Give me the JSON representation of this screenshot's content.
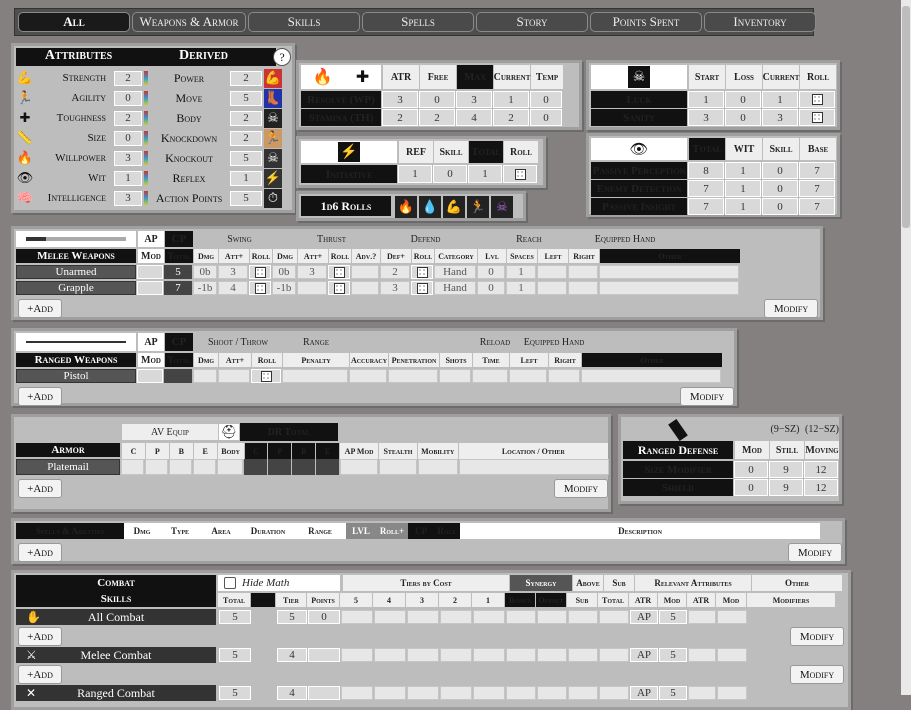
{
  "tabs": [
    "All",
    "Weapons & Armor",
    "Skills",
    "Spells",
    "Story",
    "Points Spent",
    "Inventory"
  ],
  "attributes": {
    "title": "Attributes",
    "derived_title": "Derived",
    "help": "?",
    "rows": [
      {
        "name": "Strength",
        "value": "2",
        "derived": "Power",
        "dval": "2"
      },
      {
        "name": "Agility",
        "value": "0",
        "derived": "Move",
        "dval": "5"
      },
      {
        "name": "Toughness",
        "value": "2",
        "derived": "Body",
        "dval": "2"
      },
      {
        "name": "Size",
        "value": "0",
        "derived": "Knockdown",
        "dval": "2"
      },
      {
        "name": "Willpower",
        "value": "3",
        "derived": "Knockout",
        "dval": "5"
      },
      {
        "name": "Wit",
        "value": "1",
        "derived": "Reflex",
        "dval": "1"
      },
      {
        "name": "Intelligence",
        "value": "3",
        "derived": "Action Points",
        "dval": "5"
      }
    ]
  },
  "resolve": {
    "headers": [
      "ATR",
      "Free",
      "Max",
      "Current",
      "Temp"
    ],
    "rows": [
      {
        "label": "Resolve (WP)",
        "vals": [
          "3",
          "0",
          "3",
          "1",
          "0"
        ]
      },
      {
        "label": "Stamina (TH)",
        "vals": [
          "2",
          "2",
          "4",
          "2",
          "0"
        ]
      }
    ]
  },
  "luck": {
    "headers": [
      "Start",
      "Loss",
      "Current",
      "Roll"
    ],
    "rows": [
      {
        "label": "Luck",
        "vals": [
          "1",
          "0",
          "1"
        ]
      },
      {
        "label": "Sanity",
        "vals": [
          "3",
          "0",
          "3"
        ]
      }
    ]
  },
  "initiative": {
    "headers": [
      "REF",
      "Skill",
      "Total",
      "Roll"
    ],
    "label": "Initiative",
    "vals": [
      "1",
      "0",
      "1"
    ]
  },
  "rolls": {
    "label": "1d6 Rolls"
  },
  "passive": {
    "headers": [
      "Total",
      "WIT",
      "Skill",
      "Base"
    ],
    "rows": [
      {
        "label": "Passive Perception",
        "vals": [
          "8",
          "1",
          "0",
          "7"
        ]
      },
      {
        "label": "Enemy Detection",
        "vals": [
          "7",
          "1",
          "0",
          "7"
        ]
      },
      {
        "label": "Passive Insight",
        "vals": [
          "7",
          "1",
          "0",
          "7"
        ]
      }
    ]
  },
  "melee": {
    "title": "Melee Weapons",
    "ap": "AP",
    "cp": "CP",
    "mod": "Mod",
    "total": "Total",
    "groups": [
      "Swing",
      "Thrust",
      "Defend",
      "Reach",
      "Equipped Hand"
    ],
    "sub": [
      "Dmg",
      "Att+",
      "Roll",
      "Dmg",
      "Att+",
      "Roll",
      "Adv.?",
      "Def+",
      "Roll",
      "Category",
      "Lvl",
      "Spaces",
      "Left",
      "Right",
      "Other"
    ],
    "rows": [
      {
        "name": "Unarmed",
        "cp": "5",
        "sdmg": "0b",
        "satt": "3",
        "tdmg": "0b",
        "tatt": "3",
        "def": "2",
        "cat": "Hand",
        "lvl": "0",
        "sp": "1"
      },
      {
        "name": "Grapple",
        "cp": "7",
        "sdmg": "-1b",
        "satt": "4",
        "tdmg": "-1b",
        "tatt": "",
        "def": "3",
        "cat": "Hand",
        "lvl": "0",
        "sp": "1"
      }
    ],
    "add": "+Add",
    "modify": "Modify"
  },
  "ranged": {
    "title": "Ranged Weapons",
    "ap": "AP",
    "cp": "CP",
    "mod": "Mod",
    "total": "Total",
    "groups": [
      "Shoot / Throw",
      "Range",
      "Reload",
      "Equipped Hand"
    ],
    "sub": [
      "Dmg",
      "Att+",
      "Roll",
      "Penalty",
      "Accuracy",
      "Penetration",
      "Shots",
      "Time",
      "Left",
      "Right",
      "Other"
    ],
    "rows": [
      {
        "name": "Pistol"
      }
    ],
    "add": "+Add",
    "modify": "Modify"
  },
  "armor": {
    "title": "Armor",
    "av": "AV Equip",
    "dr": "DR Total",
    "sub": [
      "C",
      "P",
      "B",
      "E",
      "Body",
      "C",
      "P",
      "B",
      "E",
      "AP Mod",
      "Stealth",
      "Mobility",
      "Location / Other"
    ],
    "rows": [
      {
        "name": "Platemail"
      }
    ],
    "add": "+Add",
    "modify": "Modify"
  },
  "rdef": {
    "title": "Ranged Defense",
    "hdr1": "(9−SZ)",
    "hdr2": "(12−SZ)",
    "headers": [
      "Mod",
      "Still",
      "Moving"
    ],
    "rows": [
      {
        "label": "Size Modifier",
        "vals": [
          "0",
          "9",
          "12"
        ]
      },
      {
        "label": "Shield",
        "vals": [
          "0",
          "9",
          "12"
        ]
      }
    ]
  },
  "spells": {
    "headers": [
      "Spells & Abilities",
      "Dmg",
      "Type",
      "Area",
      "Duration",
      "Range",
      "LVL",
      "Roll+",
      "CP",
      "Roll",
      "Description"
    ],
    "add": "+Add",
    "modify": "Modify"
  },
  "combat": {
    "title1": "Combat",
    "title2": "Skills",
    "hide": "Hide Math",
    "tiers": "Tiers by Cost",
    "synergy": "Synergy",
    "above": "Above",
    "sub": "Sub",
    "relevant": "Relevant Attributes",
    "other1": "Other",
    "other2": "Modifiers",
    "cols": [
      "Total",
      "Tier",
      "Points",
      "5",
      "4",
      "3",
      "2",
      "1",
      "Bonus",
      "Offset",
      "Sub",
      "Total",
      "ATR",
      "Mod",
      "ATR",
      "Mod"
    ],
    "rows": [
      {
        "name": "All Combat",
        "total": "5",
        "tier": "5",
        "points": "0",
        "atr": "AP",
        "mod": "5"
      },
      {
        "name": "Melee Combat",
        "total": "5",
        "tier": "4",
        "points": "",
        "atr": "AP",
        "mod": "5"
      },
      {
        "name": "Ranged Combat",
        "total": "5",
        "tier": "4",
        "points": "",
        "atr": "AP",
        "mod": "5"
      }
    ],
    "add": "+Add",
    "modify": "Modify"
  }
}
